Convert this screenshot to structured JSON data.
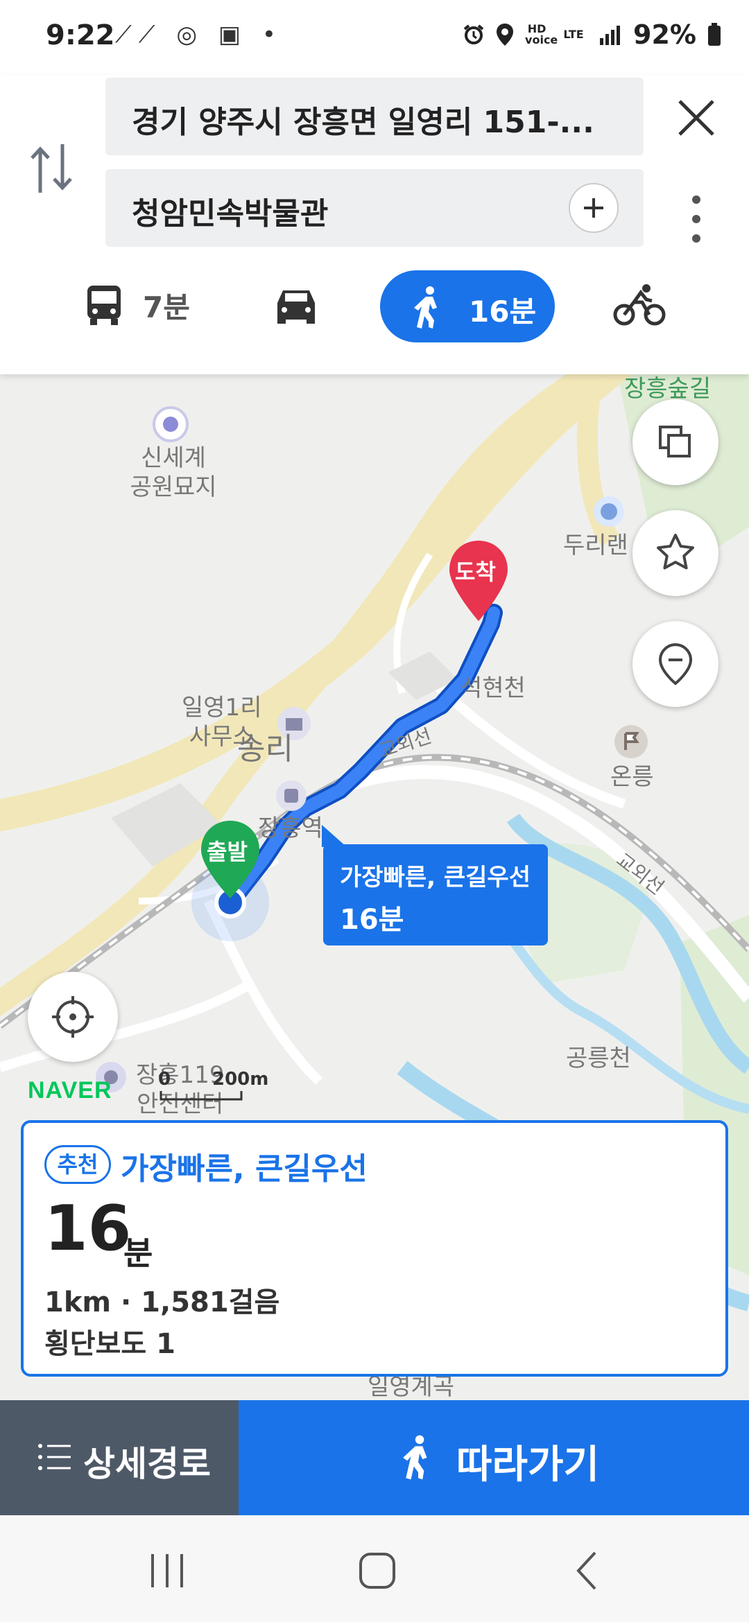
{
  "status_bar": {
    "time": "9:22",
    "left_icons": "⟋⟋ ◎ ▣ •",
    "hd_voice": "HD voice",
    "lte": "LTE",
    "battery": "92%"
  },
  "header": {
    "origin": "경기 양주시 장흥면 일영리 151-...",
    "destination": "청암민속박물관",
    "modes": [
      {
        "name": "bus",
        "label": "7분"
      },
      {
        "name": "car",
        "label": ""
      },
      {
        "name": "walk",
        "label": "16분"
      },
      {
        "name": "bike",
        "label": ""
      }
    ]
  },
  "map": {
    "labels": {
      "jangheung_forest": "장흥숲길",
      "shinsegae": "신세계\n공원묘지",
      "durirand": "두리랜",
      "ilyoung1ri": "일영1리\n사무소",
      "songri": "송리",
      "jangheung_station": "장흥역",
      "seokhyeoncheon": "석현천",
      "gyooeseon1": "교외선",
      "gyooeseon2": "교외선",
      "oreung": "온릉",
      "gongneungcheon": "공릉천",
      "safety_center": "장흥119\n안전센터",
      "ilyoung_valley": "일영계곡"
    },
    "start_pin": "출발",
    "end_pin": "도착",
    "tooltip_title": "가장빠른, 큰길우선",
    "tooltip_time": "16분",
    "scale_0": "0",
    "scale_200": "200m",
    "naver_logo": "NAVER"
  },
  "summary": {
    "badge": "추천",
    "route_name": "가장빠른, 큰길우선",
    "duration_num": "16",
    "duration_unit": "분",
    "distance": "1km · 1,581걸음",
    "crosswalk": "횡단보도 1"
  },
  "bottom": {
    "detail_label": "상세경로",
    "follow_label": "따라가기"
  },
  "colors": {
    "accent": "#1a73e8",
    "start_pin": "#1fa855",
    "end_pin": "#e8344e",
    "detail_bg": "#4e5968"
  }
}
